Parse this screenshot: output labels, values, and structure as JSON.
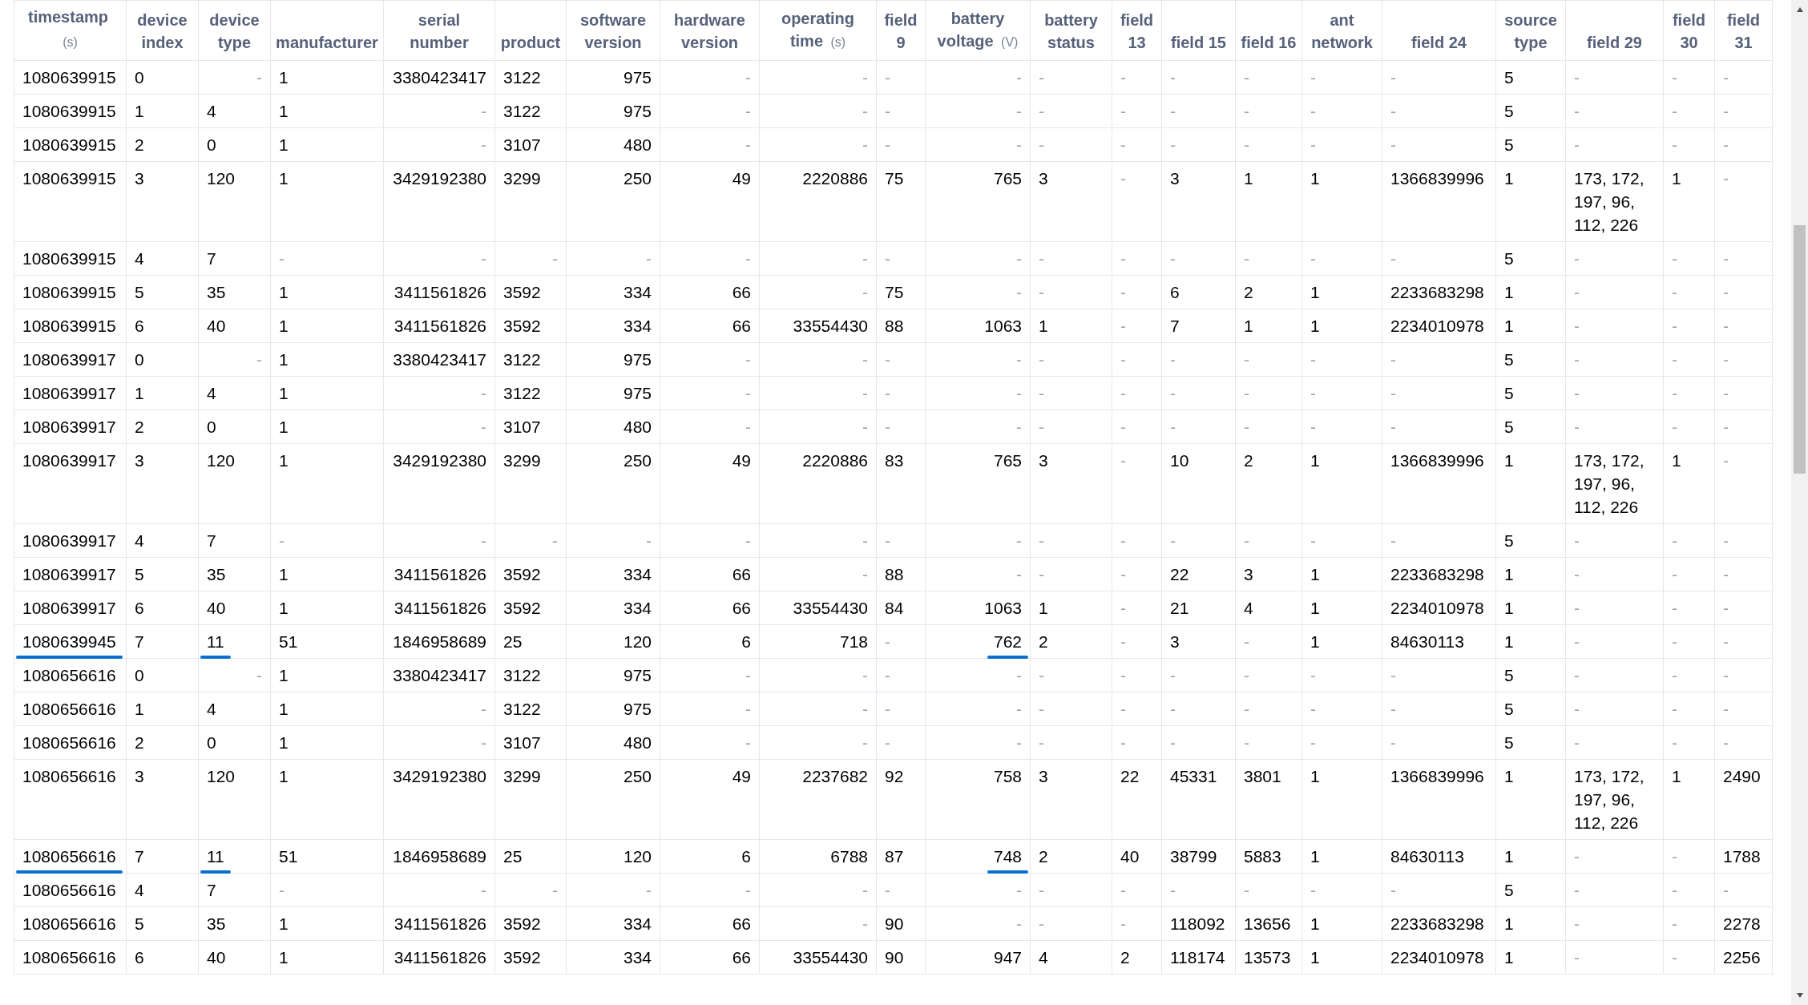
{
  "table": {
    "columns": [
      {
        "label": "timestamp",
        "unit": "(s)"
      },
      {
        "label": "device\nindex"
      },
      {
        "label": "device\ntype"
      },
      {
        "label": "manufacturer"
      },
      {
        "label": "serial\nnumber"
      },
      {
        "label": "product"
      },
      {
        "label": "software\nversion"
      },
      {
        "label": "hardware\nversion"
      },
      {
        "label": "operating\ntime",
        "unit": "(s)"
      },
      {
        "label": "field\n9"
      },
      {
        "label": "battery\nvoltage",
        "unit": "(V)"
      },
      {
        "label": "battery\nstatus"
      },
      {
        "label": "field\n13"
      },
      {
        "label": "field 15"
      },
      {
        "label": "field 16"
      },
      {
        "label": "ant\nnetwork"
      },
      {
        "label": "field 24"
      },
      {
        "label": "source\ntype"
      },
      {
        "label": "field 29"
      },
      {
        "label": "field\n30"
      },
      {
        "label": "field\n31"
      }
    ],
    "rows": [
      {
        "cells": [
          "1080639915",
          "0",
          "-",
          "1",
          "3380423417",
          "3122",
          "975",
          "-",
          "-",
          "-",
          "-",
          "-",
          "-",
          "-",
          "-",
          "-",
          "-",
          "5",
          "-",
          "-",
          "-"
        ]
      },
      {
        "cells": [
          "1080639915",
          "1",
          "4",
          "1",
          "-",
          "3122",
          "975",
          "-",
          "-",
          "-",
          "-",
          "-",
          "-",
          "-",
          "-",
          "-",
          "-",
          "5",
          "-",
          "-",
          "-"
        ]
      },
      {
        "cells": [
          "1080639915",
          "2",
          "0",
          "1",
          "-",
          "3107",
          "480",
          "-",
          "-",
          "-",
          "-",
          "-",
          "-",
          "-",
          "-",
          "-",
          "-",
          "5",
          "-",
          "-",
          "-"
        ]
      },
      {
        "cells": [
          "1080639915",
          "3",
          "120",
          "1",
          "3429192380",
          "3299",
          "250",
          "49",
          "2220886",
          "75",
          "765",
          "3",
          "-",
          "3",
          "1",
          "1",
          "1366839996",
          "1",
          "173, 172, 197, 96, 112, 226",
          "1",
          "-"
        ]
      },
      {
        "cells": [
          "1080639915",
          "4",
          "7",
          "-",
          "-",
          "-",
          "-",
          "-",
          "-",
          "-",
          "-",
          "-",
          "-",
          "-",
          "-",
          "-",
          "-",
          "5",
          "-",
          "-",
          "-"
        ]
      },
      {
        "cells": [
          "1080639915",
          "5",
          "35",
          "1",
          "3411561826",
          "3592",
          "334",
          "66",
          "-",
          "75",
          "-",
          "-",
          "-",
          "6",
          "2",
          "1",
          "2233683298",
          "1",
          "-",
          "-",
          "-"
        ]
      },
      {
        "cells": [
          "1080639915",
          "6",
          "40",
          "1",
          "3411561826",
          "3592",
          "334",
          "66",
          "33554430",
          "88",
          "1063",
          "1",
          "-",
          "7",
          "1",
          "1",
          "2234010978",
          "1",
          "-",
          "-",
          "-"
        ]
      },
      {
        "cells": [
          "1080639917",
          "0",
          "-",
          "1",
          "3380423417",
          "3122",
          "975",
          "-",
          "-",
          "-",
          "-",
          "-",
          "-",
          "-",
          "-",
          "-",
          "-",
          "5",
          "-",
          "-",
          "-"
        ]
      },
      {
        "cells": [
          "1080639917",
          "1",
          "4",
          "1",
          "-",
          "3122",
          "975",
          "-",
          "-",
          "-",
          "-",
          "-",
          "-",
          "-",
          "-",
          "-",
          "-",
          "5",
          "-",
          "-",
          "-"
        ]
      },
      {
        "cells": [
          "1080639917",
          "2",
          "0",
          "1",
          "-",
          "3107",
          "480",
          "-",
          "-",
          "-",
          "-",
          "-",
          "-",
          "-",
          "-",
          "-",
          "-",
          "5",
          "-",
          "-",
          "-"
        ]
      },
      {
        "cells": [
          "1080639917",
          "3",
          "120",
          "1",
          "3429192380",
          "3299",
          "250",
          "49",
          "2220886",
          "83",
          "765",
          "3",
          "-",
          "10",
          "2",
          "1",
          "1366839996",
          "1",
          "173, 172, 197, 96, 112, 226",
          "1",
          "-"
        ]
      },
      {
        "cells": [
          "1080639917",
          "4",
          "7",
          "-",
          "-",
          "-",
          "-",
          "-",
          "-",
          "-",
          "-",
          "-",
          "-",
          "-",
          "-",
          "-",
          "-",
          "5",
          "-",
          "-",
          "-"
        ]
      },
      {
        "cells": [
          "1080639917",
          "5",
          "35",
          "1",
          "3411561826",
          "3592",
          "334",
          "66",
          "-",
          "88",
          "-",
          "-",
          "-",
          "22",
          "3",
          "1",
          "2233683298",
          "1",
          "-",
          "-",
          "-"
        ]
      },
      {
        "cells": [
          "1080639917",
          "6",
          "40",
          "1",
          "3411561826",
          "3592",
          "334",
          "66",
          "33554430",
          "84",
          "1063",
          "1",
          "-",
          "21",
          "4",
          "1",
          "2234010978",
          "1",
          "-",
          "-",
          "-"
        ]
      },
      {
        "cells": [
          {
            "text": "1080639945",
            "underlined": true
          },
          "7",
          {
            "text": "11",
            "underlined": true
          },
          "51",
          "1846958689",
          "25",
          "120",
          "6",
          "718",
          "-",
          {
            "text": "762",
            "underlined": true
          },
          "2",
          "-",
          "3",
          "-",
          "1",
          "84630113",
          "1",
          "-",
          "-",
          "-"
        ]
      },
      {
        "cells": [
          "1080656616",
          "0",
          "-",
          "1",
          "3380423417",
          "3122",
          "975",
          "-",
          "-",
          "-",
          "-",
          "-",
          "-",
          "-",
          "-",
          "-",
          "-",
          "5",
          "-",
          "-",
          "-"
        ]
      },
      {
        "cells": [
          "1080656616",
          "1",
          "4",
          "1",
          "-",
          "3122",
          "975",
          "-",
          "-",
          "-",
          "-",
          "-",
          "-",
          "-",
          "-",
          "-",
          "-",
          "5",
          "-",
          "-",
          "-"
        ]
      },
      {
        "cells": [
          "1080656616",
          "2",
          "0",
          "1",
          "-",
          "3107",
          "480",
          "-",
          "-",
          "-",
          "-",
          "-",
          "-",
          "-",
          "-",
          "-",
          "-",
          "5",
          "-",
          "-",
          "-"
        ]
      },
      {
        "cells": [
          "1080656616",
          "3",
          "120",
          "1",
          "3429192380",
          "3299",
          "250",
          "49",
          "2237682",
          "92",
          "758",
          "3",
          "22",
          "45331",
          "3801",
          "1",
          "1366839996",
          "1",
          "173, 172, 197, 96, 112, 226",
          "1",
          "2490"
        ]
      },
      {
        "cells": [
          {
            "text": "1080656616",
            "underlined": true
          },
          "7",
          {
            "text": "11",
            "underlined": true
          },
          "51",
          "1846958689",
          "25",
          "120",
          "6",
          "6788",
          "87",
          {
            "text": "748",
            "underlined": true
          },
          "2",
          "40",
          "38799",
          "5883",
          "1",
          "84630113",
          "1",
          "-",
          "-",
          "1788"
        ]
      },
      {
        "cells": [
          "1080656616",
          "4",
          "7",
          "-",
          "-",
          "-",
          "-",
          "-",
          "-",
          "-",
          "-",
          "-",
          "-",
          "-",
          "-",
          "-",
          "-",
          "5",
          "-",
          "-",
          "-"
        ]
      },
      {
        "cells": [
          "1080656616",
          "5",
          "35",
          "1",
          "3411561826",
          "3592",
          "334",
          "66",
          "-",
          "90",
          "-",
          "-",
          "-",
          "118092",
          "13656",
          "1",
          "2233683298",
          "1",
          "-",
          "-",
          "2278"
        ]
      },
      {
        "cells": [
          "1080656616",
          "6",
          "40",
          "1",
          "3411561826",
          "3592",
          "334",
          "66",
          "33554430",
          "90",
          "947",
          "4",
          "2",
          "118174",
          "13573",
          "1",
          "2234010978",
          "1",
          "-",
          "-",
          "2256"
        ]
      }
    ]
  }
}
